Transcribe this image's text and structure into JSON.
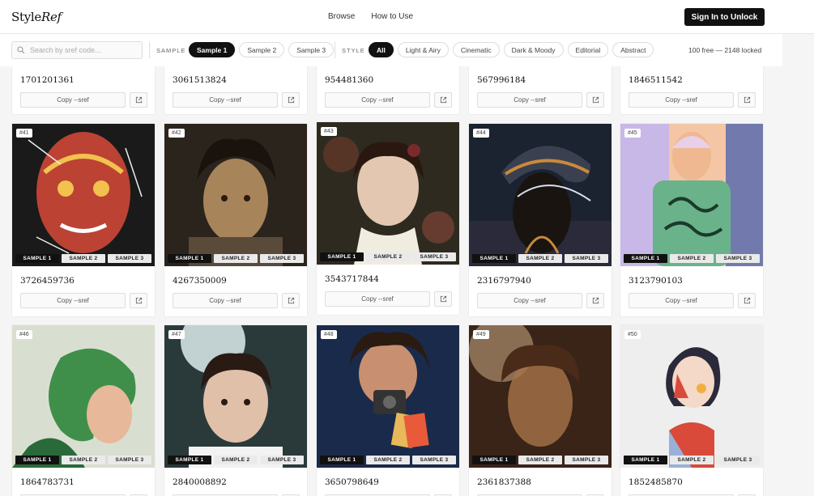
{
  "brand": {
    "name": "Style",
    "name_italic": "Ref"
  },
  "nav": {
    "browse": "Browse",
    "how_to_use": "How to Use"
  },
  "signin_label": "Sign In to Unlock",
  "search": {
    "placeholder": "Search by sref code..."
  },
  "filters": {
    "sample_label": "SAMPLE",
    "samples": [
      "Sample 1",
      "Sample 2",
      "Sample 3"
    ],
    "sample_active": 0,
    "style_label": "STYLE",
    "styles": [
      "All",
      "Light & Airy",
      "Cinematic",
      "Dark & Moody",
      "Editorial",
      "Abstract"
    ],
    "style_active": 0,
    "counts": "100 free — 2148 locked"
  },
  "card_labels": {
    "copy": "Copy --sref",
    "sample_buttons": [
      "SAMPLE 1",
      "SAMPLE 2",
      "SAMPLE 3"
    ]
  },
  "partial_row": {
    "codes": [
      "1701201361",
      "3061513824",
      "954481360",
      "567996184",
      "1846511542"
    ]
  },
  "cards": [
    {
      "num": "#41",
      "code": "3726459736",
      "palette": [
        "#1a1a1a",
        "#d94a3a",
        "#f2c14e"
      ]
    },
    {
      "num": "#42",
      "code": "4267350009",
      "palette": [
        "#2b241d",
        "#a8845a",
        "#5a4a3a"
      ]
    },
    {
      "num": "#43",
      "code": "3543717844",
      "palette": [
        "#2e2a1f",
        "#e3c7b0",
        "#7a2a2a"
      ]
    },
    {
      "num": "#44",
      "code": "2316797940",
      "palette": [
        "#1b2230",
        "#c98a3c",
        "#3a4a6a"
      ]
    },
    {
      "num": "#45",
      "code": "3123790103",
      "palette": [
        "#f4c6a5",
        "#6ab28a",
        "#3a5ab0"
      ]
    },
    {
      "num": "#46",
      "code": "1864783731",
      "palette": [
        "#d9dfd0",
        "#3f8f4a",
        "#e8b89a"
      ]
    },
    {
      "num": "#47",
      "code": "2840008892",
      "palette": [
        "#2a3a3a",
        "#8ab0b0",
        "#e0c0a8"
      ]
    },
    {
      "num": "#48",
      "code": "3650798649",
      "palette": [
        "#1a2a4a",
        "#2a1a10",
        "#e8b85a"
      ]
    },
    {
      "num": "#49",
      "code": "2361837388",
      "palette": [
        "#3a2418",
        "#a8744a",
        "#d8b890"
      ]
    },
    {
      "num": "#50",
      "code": "1852485870",
      "palette": [
        "#eeeeee",
        "#d94a3a",
        "#2a2a3a"
      ]
    }
  ]
}
